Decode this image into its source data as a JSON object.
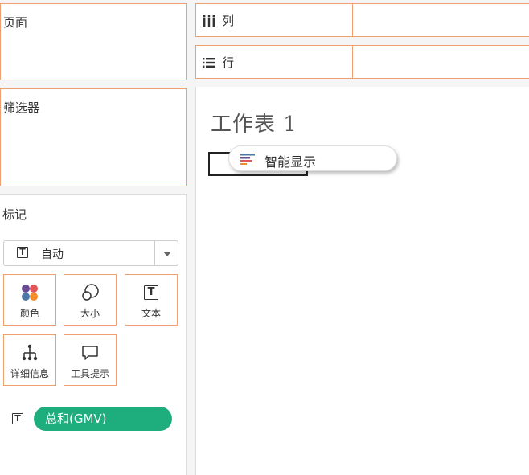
{
  "panels": {
    "pages_title": "页面",
    "filters_title": "筛选器",
    "marks_title": "标记"
  },
  "marks": {
    "mark_type": "自动",
    "cards": {
      "color": "颜色",
      "size": "大小",
      "text": "文本",
      "detail": "详细信息",
      "tooltip": "工具提示"
    },
    "field_pill": "总和(GMV)"
  },
  "shelves": {
    "columns": "列",
    "rows": "行"
  },
  "sheet": {
    "title": "工作表 1",
    "show_me": "智能显示"
  },
  "colors": {
    "accent_border": "#f0a070",
    "pill_green": "#1eae7e"
  }
}
